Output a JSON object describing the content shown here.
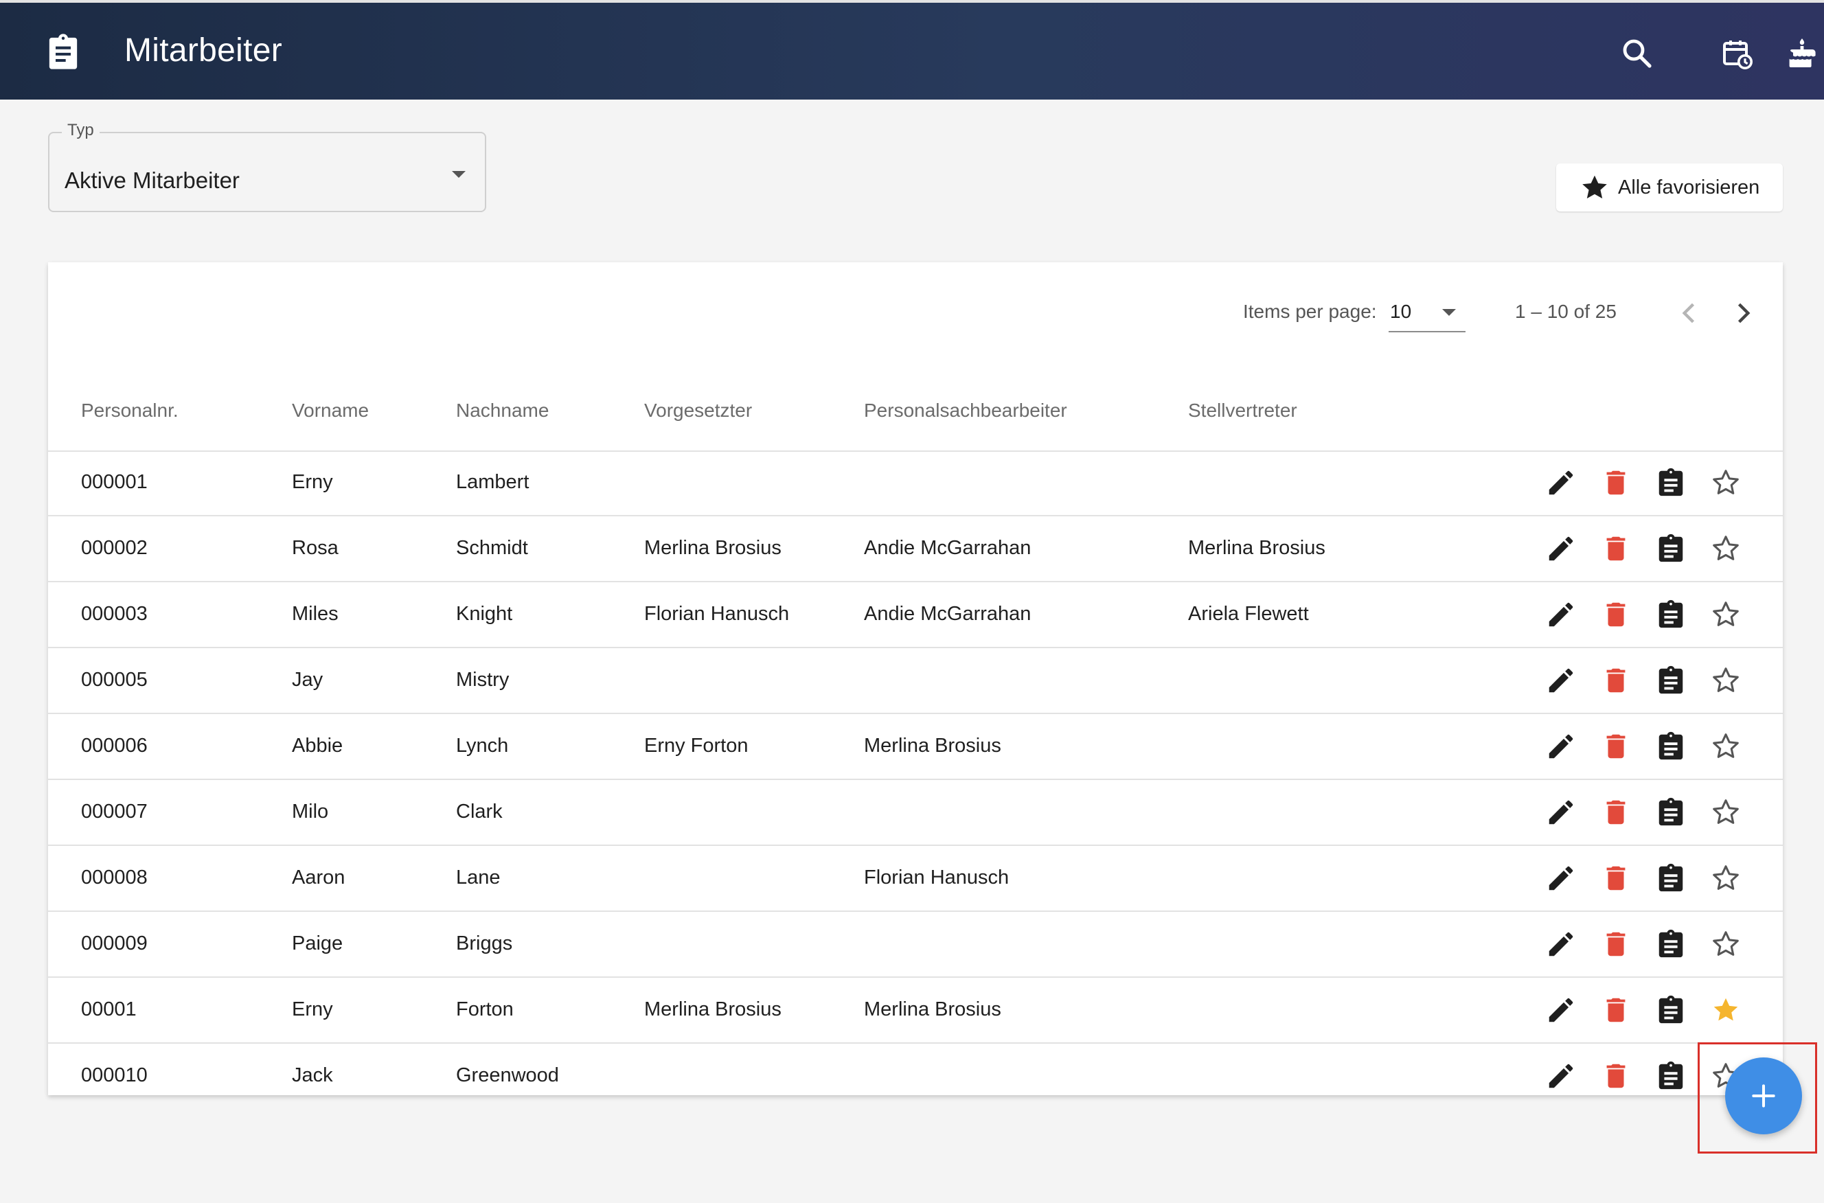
{
  "header": {
    "title": "Mitarbeiter",
    "app_icon": "clipboard-icon",
    "actions": [
      "search-icon",
      "calendar-history-icon",
      "cake-icon"
    ]
  },
  "filter": {
    "label": "Typ",
    "value": "Aktive Mitarbeiter"
  },
  "favorite_all_button": {
    "label": "Alle favorisieren",
    "icon": "star-filled-icon"
  },
  "paginator": {
    "items_per_page_label": "Items per page:",
    "items_per_page_value": "10",
    "range_label": "1 – 10 of 25"
  },
  "table": {
    "columns": [
      "Personalnr.",
      "Vorname",
      "Nachname",
      "Vorgesetzter",
      "Personalsachbearbeiter",
      "Stellvertreter"
    ],
    "rows": [
      {
        "personalnr": "000001",
        "vorname": "Erny",
        "nachname": "Lambert",
        "vorgesetzter": "",
        "personalsachbearbeiter": "",
        "stellvertreter": "",
        "favorite": false
      },
      {
        "personalnr": "000002",
        "vorname": "Rosa",
        "nachname": "Schmidt",
        "vorgesetzter": "Merlina Brosius",
        "personalsachbearbeiter": "Andie McGarrahan",
        "stellvertreter": "Merlina Brosius",
        "favorite": false
      },
      {
        "personalnr": "000003",
        "vorname": "Miles",
        "nachname": "Knight",
        "vorgesetzter": "Florian Hanusch",
        "personalsachbearbeiter": "Andie McGarrahan",
        "stellvertreter": "Ariela Flewett",
        "favorite": false
      },
      {
        "personalnr": "000005",
        "vorname": "Jay",
        "nachname": "Mistry",
        "vorgesetzter": "",
        "personalsachbearbeiter": "",
        "stellvertreter": "",
        "favorite": false
      },
      {
        "personalnr": "000006",
        "vorname": "Abbie",
        "nachname": "Lynch",
        "vorgesetzter": "Erny Forton",
        "personalsachbearbeiter": "Merlina Brosius",
        "stellvertreter": "",
        "favorite": false
      },
      {
        "personalnr": "000007",
        "vorname": "Milo",
        "nachname": "Clark",
        "vorgesetzter": "",
        "personalsachbearbeiter": "",
        "stellvertreter": "",
        "favorite": false
      },
      {
        "personalnr": "000008",
        "vorname": "Aaron",
        "nachname": "Lane",
        "vorgesetzter": "",
        "personalsachbearbeiter": "Florian Hanusch",
        "stellvertreter": "",
        "favorite": false
      },
      {
        "personalnr": "000009",
        "vorname": "Paige",
        "nachname": "Briggs",
        "vorgesetzter": "",
        "personalsachbearbeiter": "",
        "stellvertreter": "",
        "favorite": false
      },
      {
        "personalnr": "00001",
        "vorname": "Erny",
        "nachname": "Forton",
        "vorgesetzter": "Merlina Brosius",
        "personalsachbearbeiter": "Merlina Brosius",
        "stellvertreter": "",
        "favorite": true
      },
      {
        "personalnr": "000010",
        "vorname": "Jack",
        "nachname": "Greenwood",
        "vorgesetzter": "",
        "personalsachbearbeiter": "",
        "stellvertreter": "",
        "favorite": false
      }
    ],
    "row_actions": [
      "edit-icon",
      "delete-icon",
      "clipboard-icon",
      "star-icon"
    ]
  },
  "fab": {
    "icon": "plus-icon"
  },
  "colors": {
    "header_gradient_start": "#1c2b44",
    "header_gradient_end": "#2e3461",
    "delete": "#e24a3b",
    "favorite_active": "#f5b52e",
    "fab": "#3f8ee6",
    "highlight": "#d9302a"
  }
}
